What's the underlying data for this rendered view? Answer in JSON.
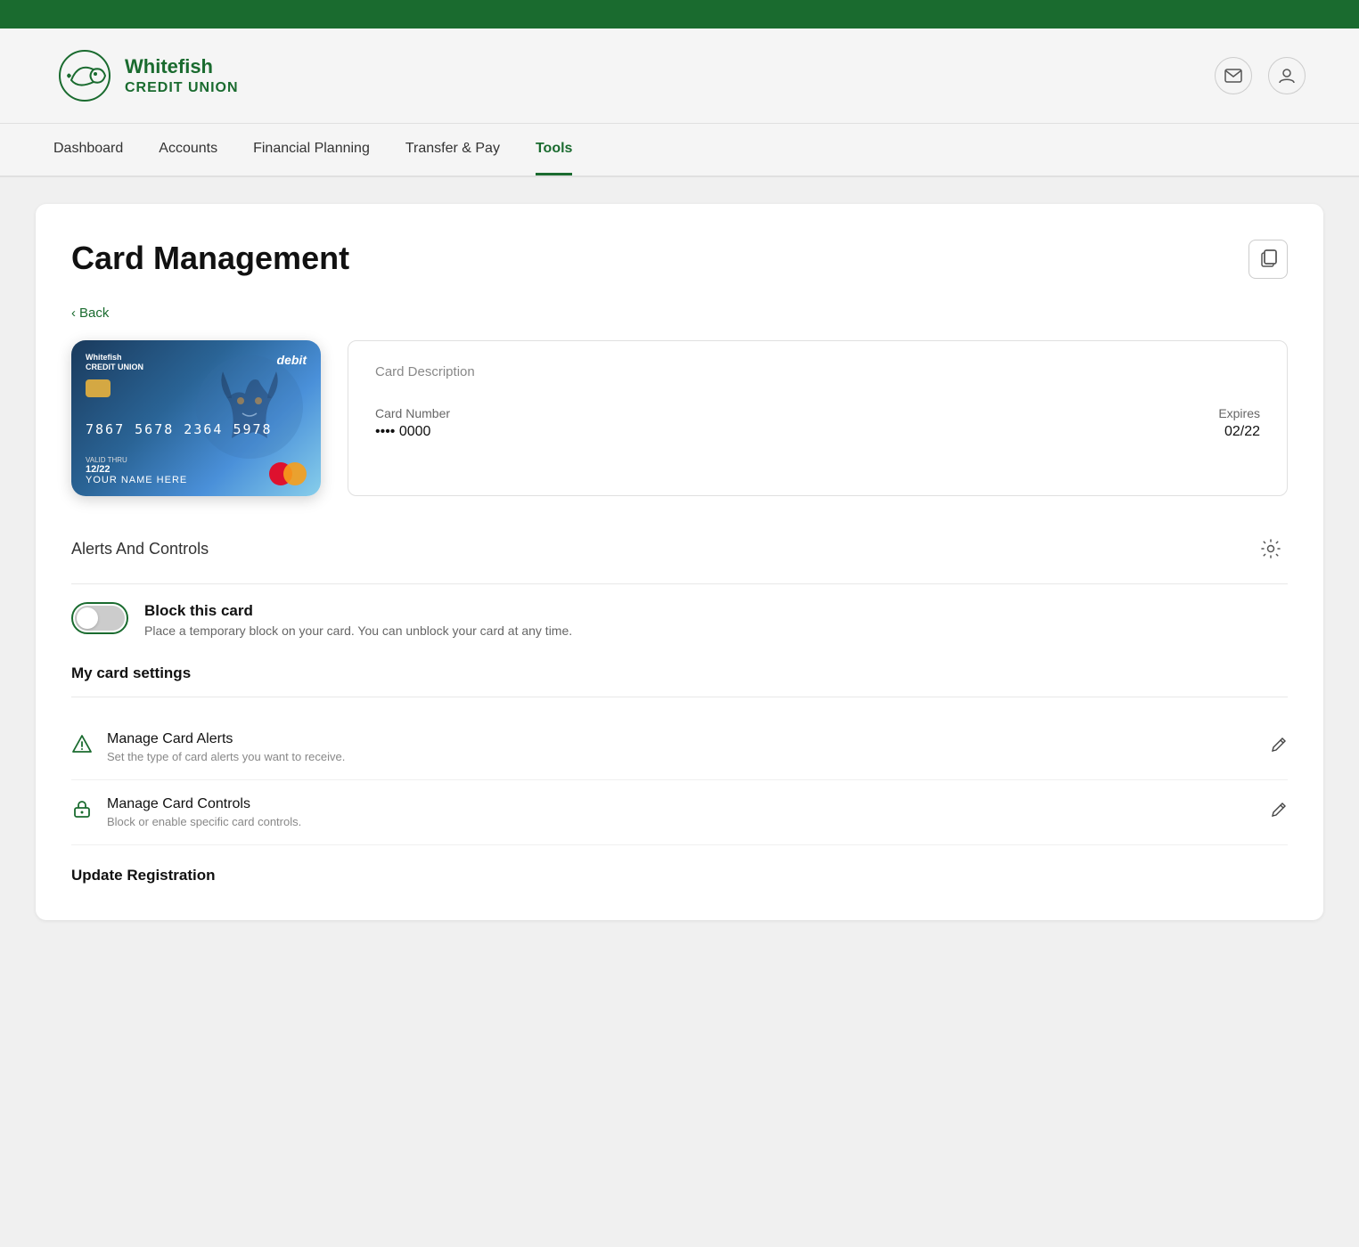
{
  "topbar": {},
  "header": {
    "logo_line1": "Whitefish",
    "logo_line2": "CREDIT UNION"
  },
  "nav": {
    "items": [
      {
        "id": "dashboard",
        "label": "Dashboard",
        "active": false
      },
      {
        "id": "accounts",
        "label": "Accounts",
        "active": false
      },
      {
        "id": "financial-planning",
        "label": "Financial Planning",
        "active": false
      },
      {
        "id": "transfer-pay",
        "label": "Transfer & Pay",
        "active": false
      },
      {
        "id": "tools",
        "label": "Tools",
        "active": true
      }
    ]
  },
  "page": {
    "title": "Card Management",
    "back_label": "Back",
    "copy_icon": "⧉"
  },
  "debit_card": {
    "logo_line1": "Whitefish",
    "logo_line2": "CREDIT UNION",
    "debit_label": "debit",
    "card_number": "7867  5678  2364  5978",
    "valid_thru_label": "VALID THRU",
    "expiry": "12/22",
    "name": "YOUR NAME HERE"
  },
  "card_desc": {
    "description_label": "Card Description",
    "card_number_label": "Card Number",
    "card_number_value": "•••• 0000",
    "expires_label": "Expires",
    "expires_value": "02/22"
  },
  "alerts": {
    "section_title": "Alerts And Controls",
    "gear_icon": "⚙",
    "block_card_label": "Block this card",
    "block_card_desc": "Place a temporary block on your card. You can unblock your card at any time."
  },
  "card_settings": {
    "section_title": "My card settings",
    "items": [
      {
        "id": "manage-alerts",
        "icon": "⚠",
        "title": "Manage Card Alerts",
        "desc": "Set the type of card alerts you want to receive.",
        "edit_icon": "✏"
      },
      {
        "id": "manage-controls",
        "icon": "🔒",
        "title": "Manage Card Controls",
        "desc": "Block or enable specific card controls.",
        "edit_icon": "✏"
      }
    ]
  },
  "update_registration": {
    "title": "Update Registration"
  }
}
